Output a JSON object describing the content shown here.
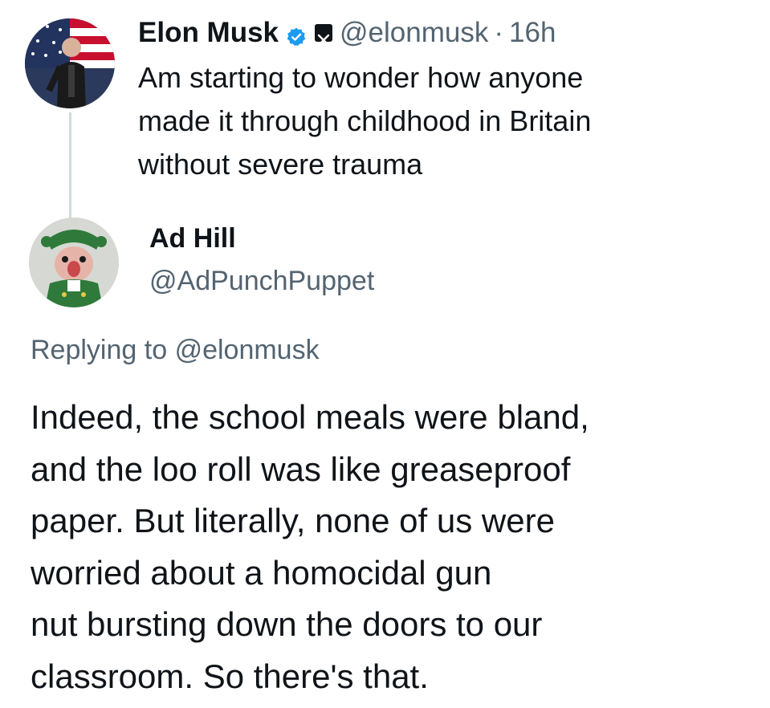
{
  "parent_tweet": {
    "author_name": "Elon Musk",
    "verified_icon": "verified-badge-icon",
    "affiliation_icon": "x-logo-icon",
    "handle": "@elonmusk",
    "separator": "·",
    "time": "16h",
    "text_lines": [
      "Am starting to wonder how anyone",
      "made it through childhood in Britain",
      "without severe trauma"
    ]
  },
  "reply_tweet": {
    "author_name": "Ad Hill",
    "handle": "@AdPunchPuppet",
    "replying_prefix": "Replying to",
    "replying_to": "@elonmusk",
    "text_lines": [
      "Indeed, the school meals were bland,",
      "and the loo roll was like greaseproof",
      "paper. But literally, none of us were",
      "worried about a homocidal gun",
      "nut bursting down the doors to our",
      "classroom. So there's that."
    ]
  },
  "colors": {
    "text_primary": "#0f1419",
    "text_secondary": "#536471",
    "verified_blue": "#1d9bf0",
    "thread_line": "#cfd9de"
  }
}
